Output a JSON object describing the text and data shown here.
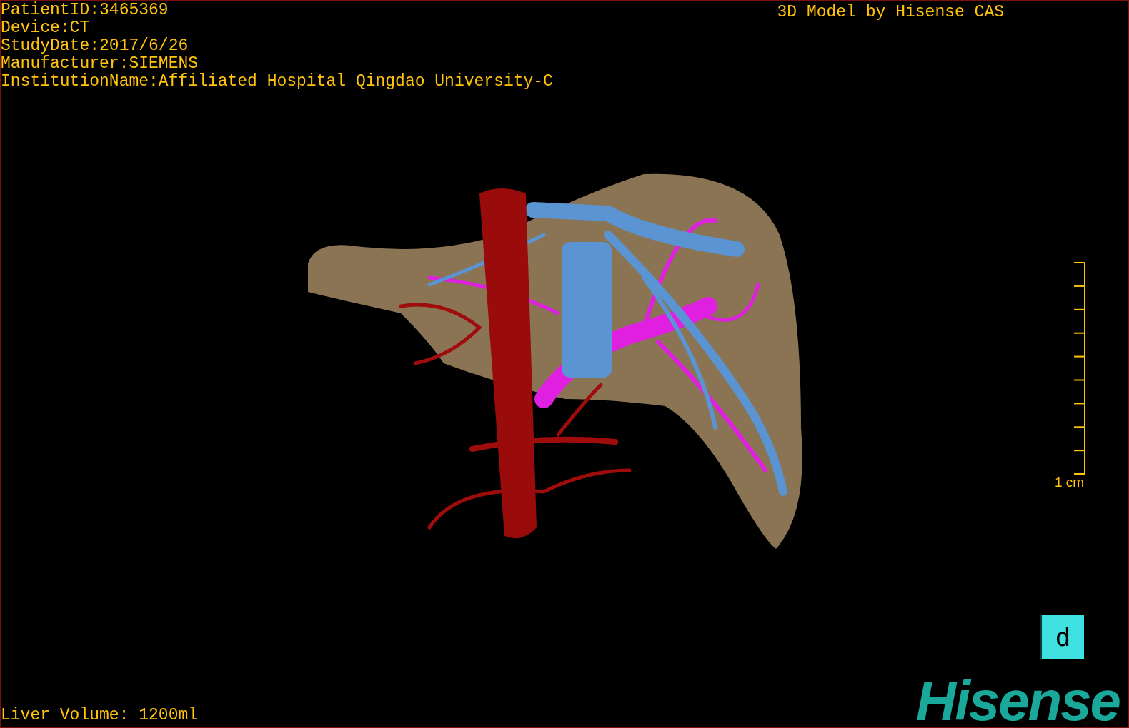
{
  "patient_info": [
    "PatientID:3465369",
    "Device:CT",
    "StudyDate:2017/6/26",
    "Manufacturer:SIEMENS",
    "InstitutionName:Affiliated Hospital Qingdao University-C"
  ],
  "title": "3D Model by Hisense CAS",
  "scale_bar": {
    "label": "1 cm"
  },
  "view_button": {
    "label": "d"
  },
  "liver_volume": "Liver Volume: 1200ml",
  "logo": {
    "text": "Hisense"
  }
}
